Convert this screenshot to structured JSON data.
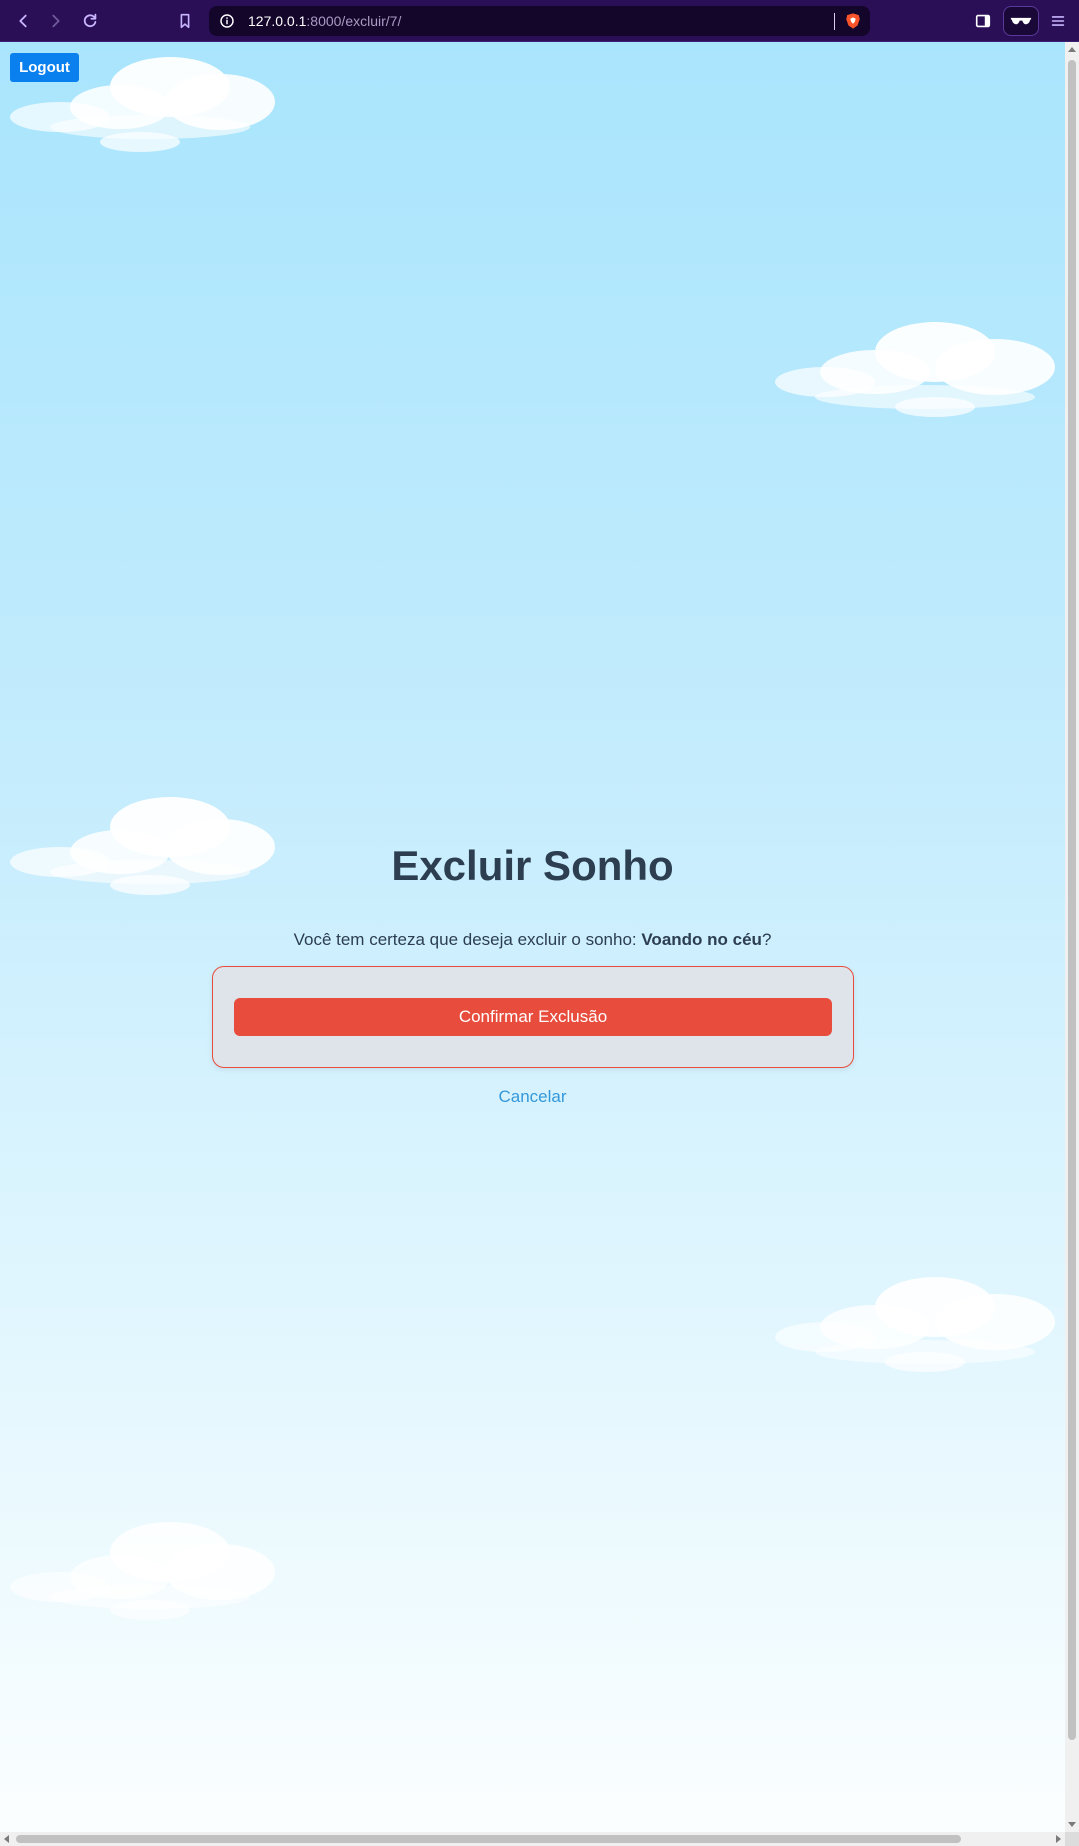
{
  "browser": {
    "url_host": "127.0.0.1",
    "url_path": ":8000/excluir/7/"
  },
  "page": {
    "logout_label": "Logout",
    "title": "Excluir Sonho",
    "confirm_prefix": "Você tem certeza que deseja excluir o sonho: ",
    "dream_name": "Voando no céu",
    "confirm_suffix": "?",
    "confirm_button": "Confirmar Exclusão",
    "cancel_link": "Cancelar"
  },
  "colors": {
    "chrome": "#2a0f57",
    "logout": "#0a80ef",
    "danger": "#e74c3c",
    "link": "#3498db",
    "heading": "#2c3e50"
  },
  "icons": [
    "back-icon",
    "forward-icon",
    "reload-icon",
    "bookmark-icon",
    "site-info-icon",
    "brave-shield-icon",
    "sidebar-icon",
    "reader-mode-icon",
    "menu-icon"
  ]
}
